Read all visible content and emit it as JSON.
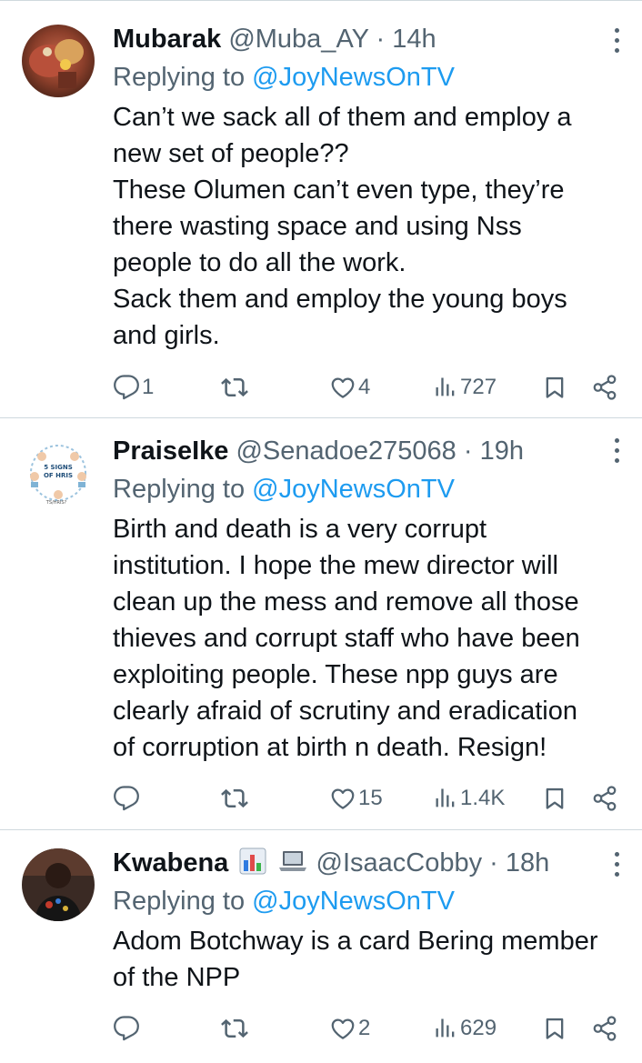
{
  "tweets": [
    {
      "name": "Mubarak",
      "handle": "@Muba_AY",
      "dot": "·",
      "time": "14h",
      "replying_prefix": "Replying to ",
      "replying_to": "@JoyNewsOnTV",
      "lines": [
        "Can’t we sack all of them and employ a",
        "new set of people??",
        "These Olumen can’t even type, they’re",
        "there wasting space and using Nss",
        "people to do all the work.",
        "Sack them and employ the young boys",
        "and girls."
      ],
      "replies": "1",
      "retweets": "",
      "likes": "4",
      "views": "727"
    },
    {
      "name": "PraiseIke",
      "handle": "@Senadoe275068",
      "dot": "·",
      "time": "19h",
      "replying_prefix": "Replying to ",
      "replying_to": "@JoyNewsOnTV",
      "lines": [
        "Birth and death is a very corrupt",
        "institution. I hope the mew director will",
        "clean up the mess and remove all those",
        "thieves and corrupt staff who have been",
        "exploiting people. These npp guys are",
        "clearly afraid of scrutiny and eradication",
        "of corruption at birth n death. Resign!"
      ],
      "replies": "",
      "retweets": "",
      "likes": "15",
      "views": "1.4K"
    },
    {
      "name": "Kwabena",
      "name_emojis": [
        "bar-chart-emoji",
        "laptop-emoji"
      ],
      "handle": "@IsaacCobby",
      "dot": "·",
      "time": "18h",
      "replying_prefix": "Replying to ",
      "replying_to": "@JoyNewsOnTV",
      "lines": [
        "Adom Botchway is a card Bering member",
        "of the NPP"
      ],
      "replies": "",
      "retweets": "",
      "likes": "2",
      "views": "629"
    }
  ],
  "avatar_1_text": {
    "title_line1": "5 SIGNS",
    "title_line2": "OF HRIS",
    "footer": "TS/HRIS?"
  },
  "colors": {
    "text": "#0f1419",
    "secondary": "#536471",
    "link": "#1d9bf0",
    "divider": "#cfd9de"
  },
  "icons": [
    "reply-icon",
    "retweet-icon",
    "like-icon",
    "views-icon",
    "bookmark-icon",
    "share-icon",
    "more-options-icon"
  ]
}
